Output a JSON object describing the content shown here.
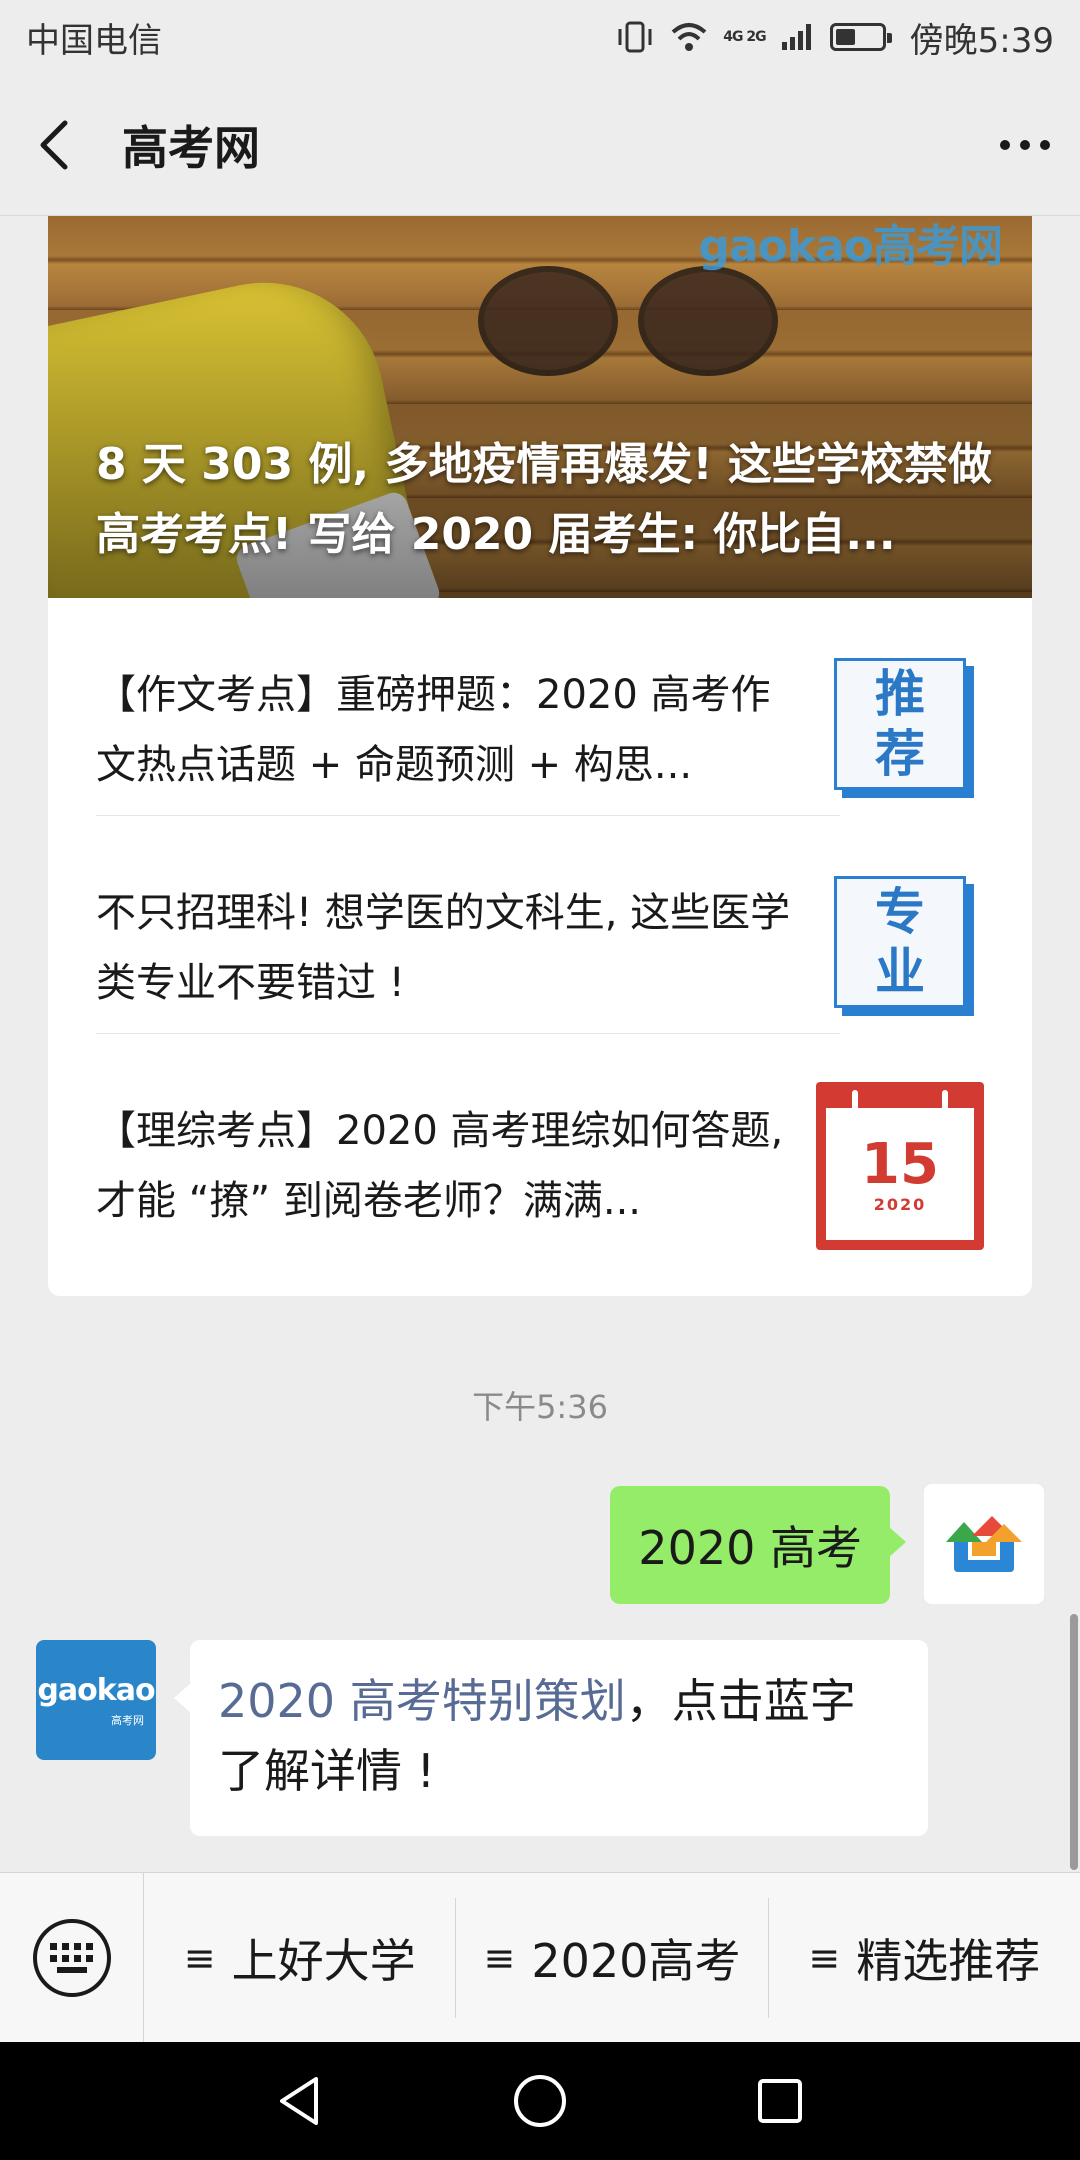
{
  "status_bar": {
    "carrier": "中国电信",
    "network": "4G 2G",
    "time": "傍晚5:39",
    "battery_level": 0.45
  },
  "header": {
    "title": "高考网"
  },
  "article_card": {
    "hero_watermark": "gaokao高考网",
    "hero_title": "8 天 303 例, 多地疫情再爆发! 这些学校禁做高考考点! 写给 2020 届考生: 你比自...",
    "items": [
      {
        "text": "【作文考点】重磅押题：2020 高考作文热点话题 + 命题预测 + 构思...",
        "thumb_line1": "推",
        "thumb_line2": "荐"
      },
      {
        "text": "不只招理科! 想学医的文科生, 这些医学类专业不要错过 !",
        "thumb_line1": "专",
        "thumb_line2": "业"
      },
      {
        "text": "【理综考点】2020 高考理综如何答题, 才能 “撩” 到阅卷老师？满满...",
        "thumb_num": "15",
        "thumb_year": "2020"
      }
    ]
  },
  "chat": {
    "timestamp": "下午5:36",
    "sent_message": "2020 高考",
    "received_link": "2020 高考特别策划",
    "received_rest": "，点击蓝字了解详情 !",
    "gaokao_avatar_logo": "gaokao",
    "gaokao_avatar_sub": "高考网"
  },
  "menu": {
    "items": [
      "上好大学",
      "2020高考",
      "精选推荐"
    ],
    "hamburger": "≡"
  },
  "colors": {
    "bubble_sent": "#95ec69",
    "link": "#576b95",
    "tile_blue": "#2b7fd0",
    "calendar_red": "#d23b31"
  }
}
